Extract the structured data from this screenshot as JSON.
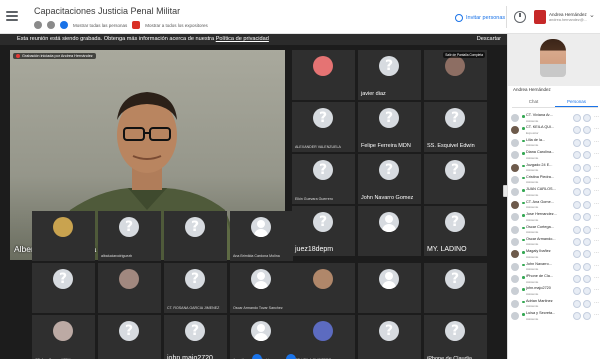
{
  "header": {
    "title": "Capacitaciones Justicia Penal Militar",
    "sub_actions": [
      "Mostrar todas las personas",
      "Mostrar a todos los expositores"
    ],
    "invite_label": "Invitar personas",
    "user_name": "Andrea Hernández",
    "user_email": "andrea.hernandez@..."
  },
  "banner": {
    "text": "Esta reunión está siendo grabada. Obtenga más información acerca de nuestra ",
    "link": "Política de privacidad",
    "dismiss": "Descartar"
  },
  "stage": {
    "recording_badge": "Grabación iniciada por Andrea Hernández",
    "main_speaker": "Albert Enrique Correa Viveros",
    "fullscreen_badge": "Salir de Pantalla Completa",
    "tiles": [
      {
        "label": "",
        "avatar": "photo",
        "style": "small",
        "color": "#e57373"
      },
      {
        "label": "javier diaz",
        "avatar": "question",
        "style": "med"
      },
      {
        "label": "",
        "avatar": "photo",
        "style": "small",
        "color": "#8d6e63"
      },
      {
        "label": "ALEXANDER VALENZUELA",
        "avatar": "question",
        "style": "small"
      },
      {
        "label": "Felipe Ferreira MDN",
        "avatar": "question",
        "style": "med"
      },
      {
        "label": "SS. Esquivel Edwin",
        "avatar": "question",
        "style": "med"
      },
      {
        "label": "Elkin Guevara Guerrero",
        "avatar": "question",
        "style": "small"
      },
      {
        "label": "John Navarro Gomez",
        "avatar": "question",
        "style": "med"
      },
      {
        "label": "",
        "avatar": "question",
        "style": "small"
      },
      {
        "label": "juez18depm",
        "avatar": "question",
        "style": "big"
      },
      {
        "label": "",
        "avatar": "generic",
        "style": "small"
      },
      {
        "label": "MY. LADINO",
        "avatar": "question",
        "style": "big"
      },
      {
        "label": "",
        "avatar": "photo",
        "style": "small",
        "color": "#c9a34f"
      },
      {
        "label": "albaluciarodriguezb",
        "avatar": "question",
        "style": "small"
      },
      {
        "label": "",
        "avatar": "question",
        "style": "small"
      },
      {
        "label": "Ana Brimilda Cardona Molina",
        "avatar": "generic",
        "style": "small"
      },
      {
        "label": "",
        "avatar": "question",
        "style": "small"
      },
      {
        "label": "",
        "avatar": "photo",
        "style": "small",
        "color": "#a1887f"
      },
      {
        "label": "CT. ROSANA GARCIA JIMENEZ",
        "avatar": "question",
        "style": "small"
      },
      {
        "label": "Oscar Armando Tovar Sanchez",
        "avatar": "generic",
        "style": "small"
      },
      {
        "label": "",
        "avatar": "photo",
        "style": "small",
        "color": "#b0876a"
      },
      {
        "label": "",
        "avatar": "generic",
        "style": "small"
      },
      {
        "label": "",
        "avatar": "question",
        "style": "small"
      },
      {
        "label": "CT. Ana Gomez 17PM",
        "avatar": "photo",
        "style": "small",
        "color": "#bcaaa4"
      },
      {
        "label": "",
        "avatar": "question",
        "style": "small"
      },
      {
        "label": "john.majo2720",
        "avatar": "question",
        "style": "big"
      },
      {
        "label": "Jose Hernandez Rodriguez",
        "avatar": "generic",
        "style": "small"
      },
      {
        "label": "CT. KEILA QUINTERO",
        "avatar": "photo",
        "style": "small",
        "color": "#5c6bc0"
      },
      {
        "label": "",
        "avatar": "question",
        "style": "small"
      },
      {
        "label": "iPhone de Claudia",
        "avatar": "question",
        "style": "med"
      },
      {
        "label": "",
        "avatar": "question",
        "style": "small"
      },
      {
        "label": "Magaly Ibañez",
        "avatar": "photo",
        "style": "med",
        "color": "#795548"
      },
      {
        "label": "",
        "avatar": "question",
        "style": "small"
      }
    ]
  },
  "panel": {
    "self_name": "Andrea Hernández",
    "tab_chat": "Chat",
    "tab_people": "Personas",
    "participants": [
      {
        "name": "CT. Viviana Ar...",
        "role": "Asistente",
        "photo": false
      },
      {
        "name": "CT. KEILA QUI...",
        "role": "Expositor",
        "photo": true
      },
      {
        "name": "Lilia de la...",
        "role": "Asistente",
        "photo": false
      },
      {
        "name": "Diana Carolina...",
        "role": "Asistente",
        "photo": false
      },
      {
        "name": "Juzgado 24 E...",
        "role": "Asistente",
        "photo": true
      },
      {
        "name": "Cristina Piedra...",
        "role": "Asistente",
        "photo": false
      },
      {
        "name": "JUAN CARLOS...",
        "role": "Asistente",
        "photo": false
      },
      {
        "name": "CT. Ana Gome...",
        "role": "Asistente",
        "photo": true
      },
      {
        "name": "Jose Hernandez...",
        "role": "Asistente",
        "photo": false
      },
      {
        "name": "Oscar Cortega...",
        "role": "Asistente",
        "photo": false
      },
      {
        "name": "Oscar Armando...",
        "role": "Asistente",
        "photo": false
      },
      {
        "name": "Magaly Ibañez",
        "role": "Asistente",
        "photo": true
      },
      {
        "name": "John Navarro...",
        "role": "Asistente",
        "photo": false
      },
      {
        "name": "iPhone de Cla...",
        "role": "Asistente",
        "photo": false
      },
      {
        "name": "john.majo2720",
        "role": "Asistente",
        "photo": false
      },
      {
        "name": "Adrian Martinez",
        "role": "Asistente",
        "photo": false
      },
      {
        "name": "Luisa y Secreta...",
        "role": "Asistente",
        "photo": false
      }
    ]
  }
}
